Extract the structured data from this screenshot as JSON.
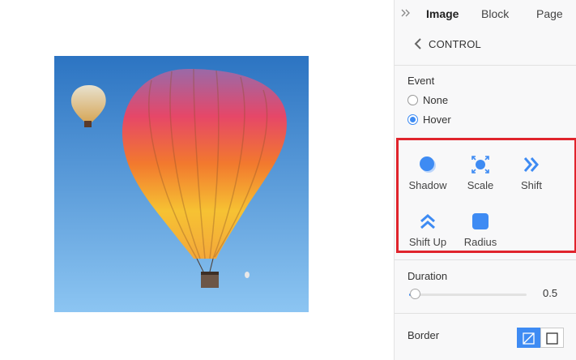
{
  "panel": {
    "tabs": [
      {
        "label": "Image",
        "active": true
      },
      {
        "label": "Block",
        "active": false
      },
      {
        "label": "Page",
        "active": false
      }
    ],
    "back_label": "CONTROL",
    "event": {
      "label": "Event",
      "options": [
        {
          "label": "None",
          "checked": false
        },
        {
          "label": "Hover",
          "checked": true
        }
      ]
    },
    "effects": [
      {
        "label": "Shadow",
        "icon": "shadow-icon"
      },
      {
        "label": "Scale",
        "icon": "scale-icon"
      },
      {
        "label": "Shift",
        "icon": "shift-right-icon"
      },
      {
        "label": "Shift Up",
        "icon": "shift-up-icon"
      },
      {
        "label": "Radius",
        "icon": "radius-icon"
      }
    ],
    "duration": {
      "label": "Duration",
      "value": "0.5",
      "fraction": 0.05
    },
    "border": {
      "label": "Border"
    },
    "colors": {
      "accent": "#3e8bf3",
      "highlight": "#e0242c"
    }
  }
}
